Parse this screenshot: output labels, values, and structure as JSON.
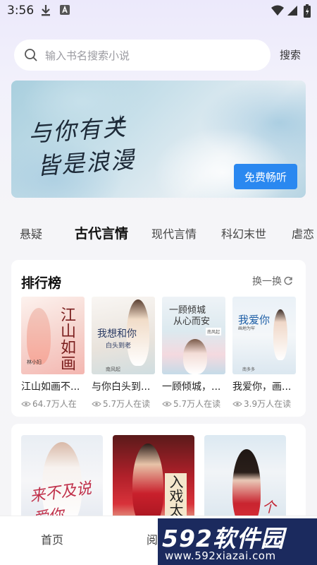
{
  "status_bar": {
    "time": "3:56",
    "icons": [
      "download-icon",
      "font-icon",
      "wifi-icon",
      "signal-icon",
      "battery-icon"
    ]
  },
  "search": {
    "placeholder": "输入书名搜索小说",
    "button_label": "搜索"
  },
  "banner": {
    "line1": "与你有关",
    "line2": "皆是浪漫",
    "button_label": "免费畅听"
  },
  "tabs": [
    {
      "label": "悬疑",
      "active": false
    },
    {
      "label": "古代言情",
      "active": true
    },
    {
      "label": "现代言情",
      "active": false
    },
    {
      "label": "科幻末世",
      "active": false
    },
    {
      "label": "虐恋",
      "active": false
    }
  ],
  "ranking": {
    "title": "排行榜",
    "refresh_label": "换一换",
    "books": [
      {
        "title": "江山如画不...",
        "reads": "64.7万人在",
        "cover": {
          "main": "江山如画",
          "author": "林小妇"
        }
      },
      {
        "title": "与你白头到...",
        "reads": "5.7万人在读",
        "cover": {
          "main": "我想和你",
          "sub": "白头到老",
          "author": "南风起"
        }
      },
      {
        "title": "一顾倾城，...",
        "reads": "5.7万人在读",
        "cover": {
          "main": "一顾倾城",
          "sub": "从心而安",
          "badge": "南风起"
        }
      },
      {
        "title": "我爱你，画...",
        "reads": "3.9万人在读",
        "cover": {
          "main": "我爱你",
          "sub": "画地为牢",
          "author": "南多多"
        }
      }
    ]
  },
  "recommend": {
    "covers": [
      {
        "text": "来不及说爱你"
      },
      {
        "text": "入戏太"
      },
      {
        "text": "个"
      }
    ]
  },
  "bottom_nav": {
    "home_label": "首页",
    "read_label": "阅"
  },
  "watermark": {
    "logo_num": "592",
    "logo_text": "软件园",
    "url": "www.592xiazai.com"
  },
  "colors": {
    "accent": "#2a88f0",
    "watermark_bg": "#1b2a5e"
  }
}
